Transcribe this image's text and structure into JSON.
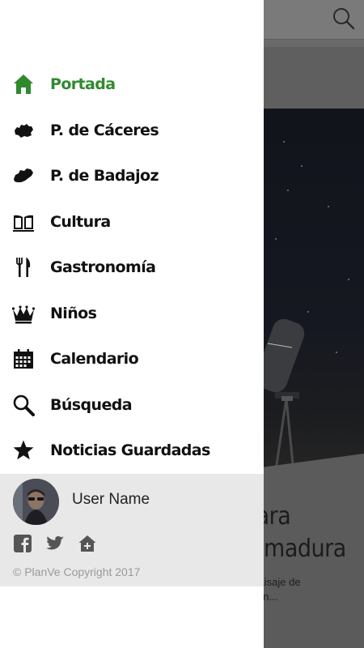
{
  "background": {
    "headline_visible": "para\nremadura",
    "excerpt_visible": "n Paisaje de\nno en..."
  },
  "drawer": {
    "menu": [
      {
        "label": "Portada",
        "icon": "home-icon",
        "active": true
      },
      {
        "label": "P. de Cáceres",
        "icon": "caceres-map-icon",
        "active": false
      },
      {
        "label": "P. de Badajoz",
        "icon": "badajoz-map-icon",
        "active": false
      },
      {
        "label": "Cultura",
        "icon": "book-icon",
        "active": false
      },
      {
        "label": "Gastronomía",
        "icon": "cutlery-icon",
        "active": false
      },
      {
        "label": "Niños",
        "icon": "crown-icon",
        "active": false
      },
      {
        "label": "Calendario",
        "icon": "calendar-icon",
        "active": false
      },
      {
        "label": "Búsqueda",
        "icon": "search-icon",
        "active": false
      },
      {
        "label": "Noticias Guardadas",
        "icon": "star-icon",
        "active": false
      }
    ],
    "profile": {
      "user_name": "User Name",
      "social": [
        "facebook-icon",
        "twitter-icon",
        "add-to-home-icon"
      ]
    },
    "copyright": "© PlanVe Copyright 2017"
  },
  "colors": {
    "accent_green": "#2f8a2e",
    "drawer_bg": "#ffffff",
    "profile_bg": "#e8e8e8",
    "scrim": "#6a6a6a"
  }
}
